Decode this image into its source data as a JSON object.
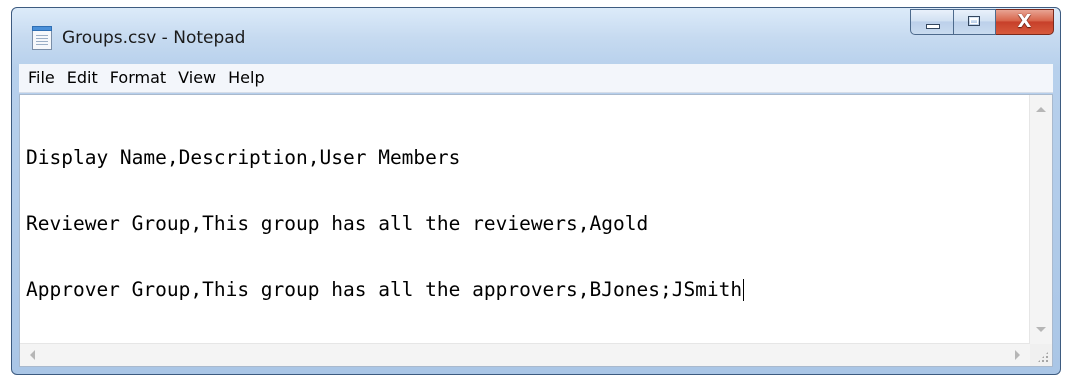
{
  "window": {
    "title": "Groups.csv - Notepad",
    "icon": "notepad-icon"
  },
  "caption_buttons": {
    "minimize_icon": "minimize-icon",
    "maximize_icon": "maximize-icon",
    "close_glyph": "X"
  },
  "menu": {
    "items": [
      {
        "label": "File"
      },
      {
        "label": "Edit"
      },
      {
        "label": "Format"
      },
      {
        "label": "View"
      },
      {
        "label": "Help"
      }
    ]
  },
  "editor": {
    "lines": [
      "Display Name,Description,User Members",
      "Reviewer Group,This group has all the reviewers,Agold",
      "Approver Group,This group has all the approvers,BJones;JSmith"
    ]
  },
  "colors": {
    "close_button": "#c7402a",
    "frame": "#b7d0ec"
  }
}
